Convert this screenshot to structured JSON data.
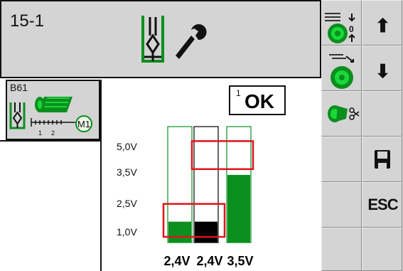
{
  "header": {
    "screen_id": "15-1",
    "icon": "tool-maintenance-icon"
  },
  "tool_card": {
    "id": "B61",
    "position_labels": [
      "1",
      "2"
    ],
    "motor_label": "M1"
  },
  "status": {
    "index": "1",
    "text": "OK"
  },
  "chart_data": {
    "type": "bar",
    "y_ticks": [
      "5,0V",
      "3,5V",
      "2,5V",
      "1,0V"
    ],
    "bar_labels": [
      "2,4V",
      "2,4V",
      "3,5V"
    ],
    "values": [
      2.4,
      2.4,
      3.5
    ],
    "ylim": [
      0,
      6.0
    ],
    "colors": [
      "#0a8f1e",
      "#000000",
      "#0a8f1e"
    ],
    "outline_colors": [
      "#0a8f1e",
      "#000000",
      "#0a8f1e"
    ],
    "highlight_color": "#e0141e"
  },
  "sidebar": {
    "buttons": [
      {
        "name": "spool-feed-direction-button",
        "icon": "spool-direction-icon"
      },
      {
        "name": "arrow-up-button",
        "label": "⬆"
      },
      {
        "name": "spool-load-button",
        "icon": "spool-load-icon"
      },
      {
        "name": "arrow-down-button",
        "label": "⬇"
      },
      {
        "name": "spool-cut-button",
        "icon": "spool-cut-icon"
      },
      {
        "name": "save-button",
        "icon": "save-icon"
      },
      {
        "name": "escape-button",
        "label": "ESC"
      }
    ]
  }
}
